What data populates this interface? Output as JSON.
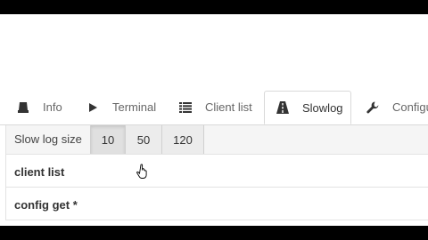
{
  "tabs": [
    {
      "label": "Info",
      "icon": "database-icon"
    },
    {
      "label": "Terminal",
      "icon": "play-icon"
    },
    {
      "label": "Client list",
      "icon": "list-icon"
    },
    {
      "label": "Slowlog",
      "icon": "road-icon",
      "active": true
    },
    {
      "label": "Configu",
      "icon": "wrench-icon"
    }
  ],
  "slowlog": {
    "size_label": "Slow log size",
    "sizes": [
      "10",
      "50",
      "120"
    ],
    "selected": "10"
  },
  "entries": [
    {
      "command": "client list"
    },
    {
      "command": "config get *"
    }
  ]
}
